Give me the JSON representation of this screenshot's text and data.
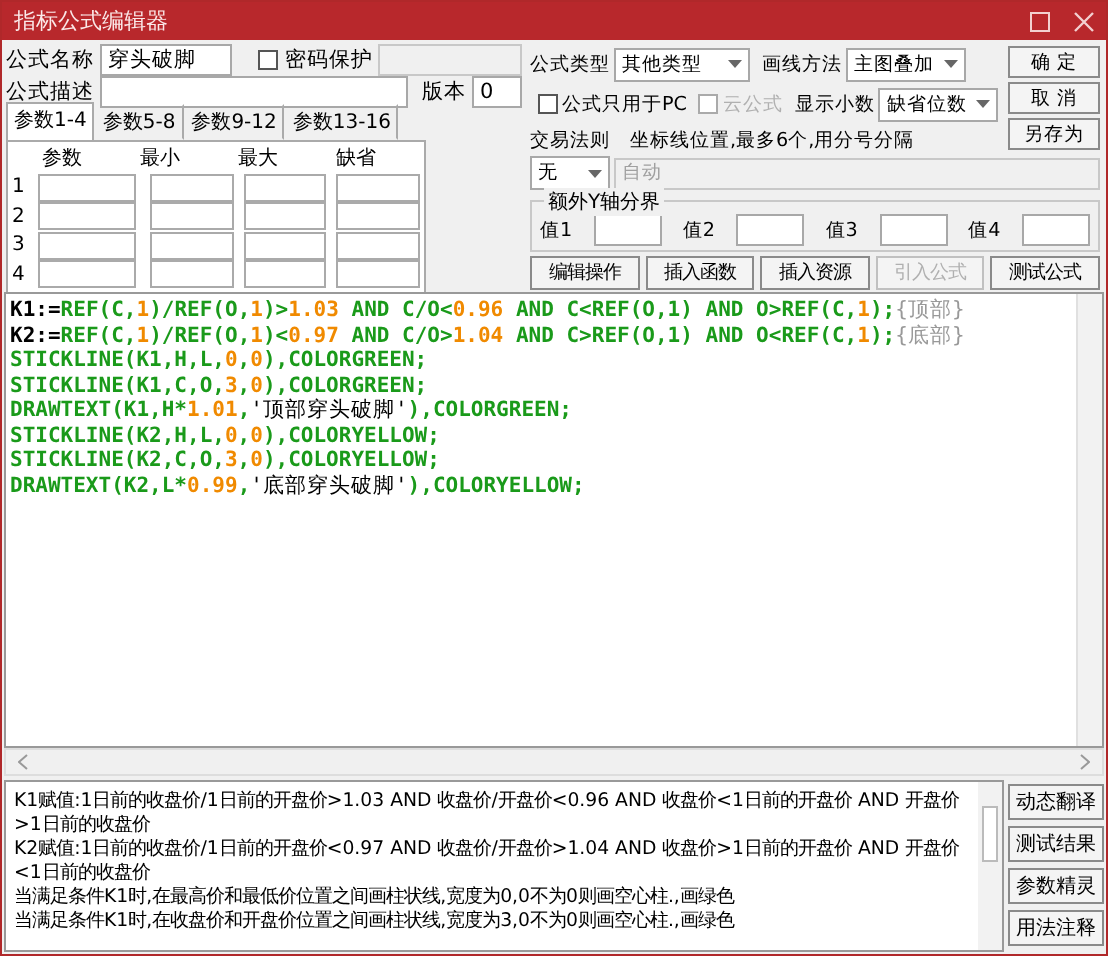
{
  "window": {
    "title": "指标公式编辑器"
  },
  "name": {
    "label": "公式名称",
    "value": "穿头破脚"
  },
  "password": {
    "label": "密码保护",
    "checked": false
  },
  "description": {
    "label": "公式描述"
  },
  "version": {
    "label": "版本",
    "value": "0"
  },
  "formula_type": {
    "label": "公式类型",
    "value": "其他类型"
  },
  "draw_method": {
    "label": "画线方法",
    "value": "主图叠加"
  },
  "pc_only": {
    "label": "公式只用于PC",
    "checked": false
  },
  "cloud": {
    "label": "云公式",
    "checked": false,
    "disabled": true
  },
  "decimals": {
    "label": "显示小数",
    "value": "缺省位数"
  },
  "trade_rule": {
    "label": "交易法则",
    "value": "无"
  },
  "axis_lines": {
    "label": "坐标线位置,最多6个,用分号分隔",
    "value": "自动",
    "disabled": true
  },
  "extra_y": {
    "title": "额外Y轴分界",
    "fields": [
      {
        "label": "值1"
      },
      {
        "label": "值2"
      },
      {
        "label": "值3"
      },
      {
        "label": "值4"
      }
    ]
  },
  "dialog_buttons": [
    {
      "label": "确  定"
    },
    {
      "label": "取  消"
    },
    {
      "label": "另存为"
    }
  ],
  "action_buttons": [
    {
      "label": "编辑操作",
      "disabled": false
    },
    {
      "label": "插入函数",
      "disabled": false
    },
    {
      "label": "插入资源",
      "disabled": false
    },
    {
      "label": "引入公式",
      "disabled": true
    },
    {
      "label": "测试公式",
      "disabled": false
    }
  ],
  "tabs": [
    {
      "label": "参数1-4",
      "selected": true
    },
    {
      "label": "参数5-8",
      "selected": false
    },
    {
      "label": "参数9-12",
      "selected": false
    },
    {
      "label": "参数13-16",
      "selected": false
    }
  ],
  "params": {
    "columns": [
      "参数",
      "最小",
      "最大",
      "缺省"
    ],
    "rows": [
      "1",
      "2",
      "3",
      "4"
    ]
  },
  "code": [
    [
      {
        "kind": "var",
        "text": "K1:="
      },
      {
        "kind": "fn",
        "text": "REF(C,"
      },
      {
        "kind": "num",
        "text": "1"
      },
      {
        "kind": "fn",
        "text": ")/REF(O,"
      },
      {
        "kind": "num",
        "text": "1"
      },
      {
        "kind": "fn",
        "text": ")>"
      },
      {
        "kind": "num",
        "text": "1.03"
      },
      {
        "kind": "fn",
        "text": " AND C/O<"
      },
      {
        "kind": "num",
        "text": "0.96"
      },
      {
        "kind": "fn",
        "text": " AND C<REF(O,1) AND O>REF(C,"
      },
      {
        "kind": "num",
        "text": "1"
      },
      {
        "kind": "fn",
        "text": ");"
      },
      {
        "kind": "comment",
        "text": "{顶部}"
      }
    ],
    [
      {
        "kind": "var",
        "text": "K2:="
      },
      {
        "kind": "fn",
        "text": "REF(C,"
      },
      {
        "kind": "num",
        "text": "1"
      },
      {
        "kind": "fn",
        "text": ")/REF(O,"
      },
      {
        "kind": "num",
        "text": "1"
      },
      {
        "kind": "fn",
        "text": ")<"
      },
      {
        "kind": "num",
        "text": "0.97"
      },
      {
        "kind": "fn",
        "text": " AND C/O>"
      },
      {
        "kind": "num",
        "text": "1.04"
      },
      {
        "kind": "fn",
        "text": " AND C>REF(O,1) AND O<REF(C,"
      },
      {
        "kind": "num",
        "text": "1"
      },
      {
        "kind": "fn",
        "text": ");"
      },
      {
        "kind": "comment",
        "text": "{底部}"
      }
    ],
    [
      {
        "kind": "fn",
        "text": "STICKLINE(K1,H,L,"
      },
      {
        "kind": "num",
        "text": "0"
      },
      {
        "kind": "fn",
        "text": ","
      },
      {
        "kind": "num",
        "text": "0"
      },
      {
        "kind": "fn",
        "text": "),COLORGREEN;"
      }
    ],
    [
      {
        "kind": "fn",
        "text": "STICKLINE(K1,C,O,"
      },
      {
        "kind": "num",
        "text": "3"
      },
      {
        "kind": "fn",
        "text": ","
      },
      {
        "kind": "num",
        "text": "0"
      },
      {
        "kind": "fn",
        "text": "),COLORGREEN;"
      }
    ],
    [
      {
        "kind": "fn",
        "text": "DRAWTEXT(K1,H*"
      },
      {
        "kind": "num",
        "text": "1.01"
      },
      {
        "kind": "fn",
        "text": ","
      },
      {
        "kind": "str",
        "text": "'顶部穿头破脚'"
      },
      {
        "kind": "fn",
        "text": "),COLORGREEN;"
      }
    ],
    [
      {
        "kind": "fn",
        "text": "STICKLINE(K2,H,L,"
      },
      {
        "kind": "num",
        "text": "0"
      },
      {
        "kind": "fn",
        "text": ","
      },
      {
        "kind": "num",
        "text": "0"
      },
      {
        "kind": "fn",
        "text": "),COLORYELLOW;"
      }
    ],
    [
      {
        "kind": "fn",
        "text": "STICKLINE(K2,C,O,"
      },
      {
        "kind": "num",
        "text": "3"
      },
      {
        "kind": "fn",
        "text": ","
      },
      {
        "kind": "num",
        "text": "0"
      },
      {
        "kind": "fn",
        "text": "),COLORYELLOW;"
      }
    ],
    [
      {
        "kind": "fn",
        "text": "DRAWTEXT(K2,L*"
      },
      {
        "kind": "num",
        "text": "0.99"
      },
      {
        "kind": "fn",
        "text": ","
      },
      {
        "kind": "str",
        "text": "'底部穿头破脚'"
      },
      {
        "kind": "fn",
        "text": "),COLORYELLOW;"
      }
    ]
  ],
  "explanation": [
    "K1赋值:1日前的收盘价/1日前的开盘价>1.03 AND 收盘价/开盘价<0.96 AND 收盘价<1日前的开盘价 AND 开盘价>1日前的收盘价",
    "K2赋值:1日前的收盘价/1日前的开盘价<0.97 AND 收盘价/开盘价>1.04 AND 收盘价>1日前的开盘价 AND 开盘价<1日前的收盘价",
    "当满足条件K1时,在最高价和最低价位置之间画柱状线,宽度为0,0不为0则画空心柱.,画绿色",
    "当满足条件K1时,在收盘价和开盘价位置之间画柱状线,宽度为3,0不为0则画空心柱.,画绿色"
  ],
  "side_buttons": [
    {
      "label": "动态翻译"
    },
    {
      "label": "测试结果"
    },
    {
      "label": "参数精灵"
    },
    {
      "label": "用法注释"
    }
  ]
}
